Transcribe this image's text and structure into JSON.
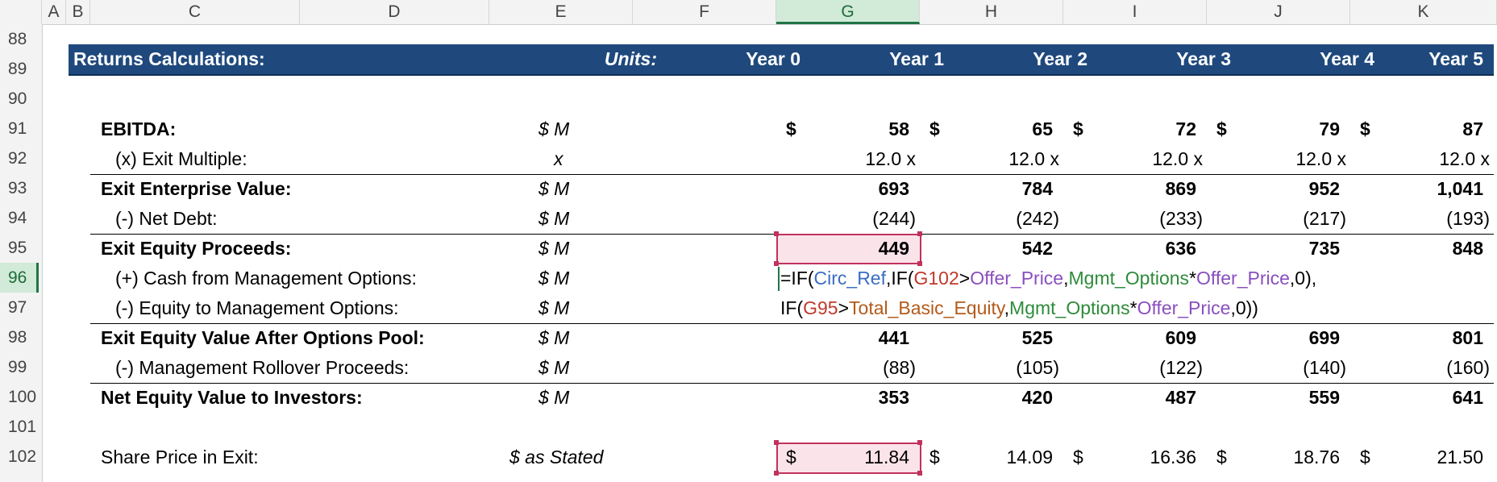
{
  "columns": [
    "A",
    "B",
    "C",
    "D",
    "E",
    "F",
    "G",
    "H",
    "I",
    "J",
    "K"
  ],
  "selected_column": "G",
  "rows": [
    "88",
    "89",
    "90",
    "91",
    "92",
    "93",
    "94",
    "95",
    "96",
    "97",
    "98",
    "99",
    "100",
    "101",
    "102"
  ],
  "selected_row": "96",
  "header": {
    "title": "Returns Calculations:",
    "units": "Units:",
    "years": [
      "Year 0",
      "Year 1",
      "Year 2",
      "Year 3",
      "Year 4",
      "Year 5"
    ]
  },
  "table": {
    "ebitda": {
      "label": "EBITDA:",
      "unit": "$ M",
      "cur": "$",
      "values": [
        "58",
        "65",
        "72",
        "79",
        "87"
      ]
    },
    "exit_multiple": {
      "label": "(x) Exit Multiple:",
      "unit": "x",
      "values": [
        "12.0 x",
        "12.0 x",
        "12.0 x",
        "12.0 x",
        "12.0 x"
      ]
    },
    "exit_ev": {
      "label": "Exit Enterprise Value:",
      "unit": "$ M",
      "values": [
        "693",
        "784",
        "869",
        "952",
        "1,041"
      ]
    },
    "net_debt": {
      "label": "(-) Net Debt:",
      "unit": "$ M",
      "values": [
        "(244)",
        "(242)",
        "(233)",
        "(217)",
        "(193)"
      ]
    },
    "exit_equity": {
      "label": "Exit Equity Proceeds:",
      "unit": "$ M",
      "values": [
        "449",
        "542",
        "636",
        "735",
        "848"
      ]
    },
    "cash_mgmt": {
      "label": "(+) Cash from Management Options:",
      "unit": "$ M"
    },
    "equity_mgmt": {
      "label": "(-) Equity to Management Options:",
      "unit": "$ M"
    },
    "after_pool": {
      "label": "Exit Equity Value After Options Pool:",
      "unit": "$ M",
      "values": [
        "441",
        "525",
        "609",
        "699",
        "801"
      ]
    },
    "rollover": {
      "label": "(-) Management Rollover Proceeds:",
      "unit": "$ M",
      "values": [
        "(88)",
        "(105)",
        "(122)",
        "(140)",
        "(160)"
      ]
    },
    "net_equity": {
      "label": "Net Equity Value to Investors:",
      "unit": "$ M",
      "values": [
        "353",
        "420",
        "487",
        "559",
        "641"
      ]
    },
    "share_price": {
      "label": "Share Price in Exit:",
      "unit": "$ as Stated",
      "cur": "$",
      "values": [
        "11.84",
        "14.09",
        "16.36",
        "18.76",
        "21.50"
      ]
    }
  },
  "formula": {
    "line1": [
      {
        "t": "=IF(",
        "c": "def"
      },
      {
        "t": "Circ_Ref",
        "c": "blue"
      },
      {
        "t": ",IF(",
        "c": "def"
      },
      {
        "t": "G102",
        "c": "red"
      },
      {
        "t": ">",
        "c": "def"
      },
      {
        "t": "Offer_Price",
        "c": "purple"
      },
      {
        "t": ",",
        "c": "def"
      },
      {
        "t": "Mgmt_Options",
        "c": "green"
      },
      {
        "t": "*",
        "c": "def"
      },
      {
        "t": "Offer_Price",
        "c": "purple"
      },
      {
        "t": ",0),",
        "c": "def"
      }
    ],
    "line2": [
      {
        "t": "IF(",
        "c": "def"
      },
      {
        "t": "G95",
        "c": "red"
      },
      {
        "t": ">",
        "c": "def"
      },
      {
        "t": "Total_Basic_Equity",
        "c": "orange"
      },
      {
        "t": ",",
        "c": "def"
      },
      {
        "t": "Mgmt_Options",
        "c": "green"
      },
      {
        "t": "*",
        "c": "def"
      },
      {
        "t": "Offer_Price",
        "c": "purple"
      },
      {
        "t": ",0))",
        "c": "def"
      }
    ]
  },
  "colors": {
    "banner": "#1f497d",
    "selection": "#c0325c",
    "selection_fill": "#fbe3ea"
  }
}
